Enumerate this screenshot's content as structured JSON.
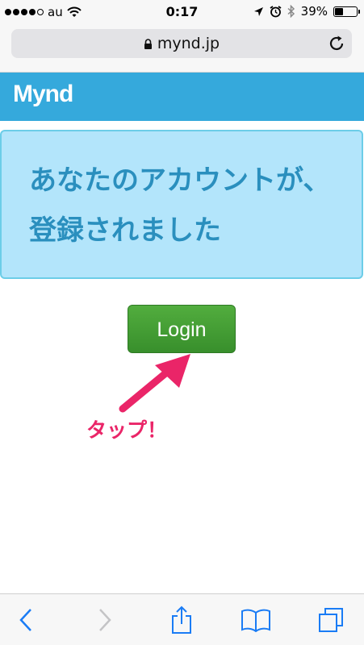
{
  "status_bar": {
    "carrier": "au",
    "time": "0:17",
    "battery_percent": "39%",
    "battery_level": 0.39
  },
  "browser": {
    "url": "mynd.jp"
  },
  "site": {
    "logo_text": "Mynd"
  },
  "notice": {
    "message": "あなたのアカウントが、登録されました"
  },
  "login_button": {
    "label": "Login"
  },
  "annotation": {
    "text": "タップ！"
  },
  "colors": {
    "header": "#35a9dc",
    "notice_bg": "#b3e5fb",
    "notice_text": "#2a8fbe",
    "button": "#45a036",
    "annotation": "#ea2568",
    "ios_blue": "#1a7cf5"
  },
  "icons": {
    "signal": "signal-dots-icon",
    "wifi": "wifi-icon",
    "location": "location-arrow-icon",
    "alarm": "alarm-clock-icon",
    "bluetooth": "bluetooth-icon",
    "battery": "battery-icon",
    "lock": "lock-icon",
    "reload": "reload-icon",
    "back": "back-chevron-icon",
    "forward": "forward-chevron-icon",
    "share": "share-icon",
    "bookmarks": "book-icon",
    "tabs": "tabs-icon"
  }
}
